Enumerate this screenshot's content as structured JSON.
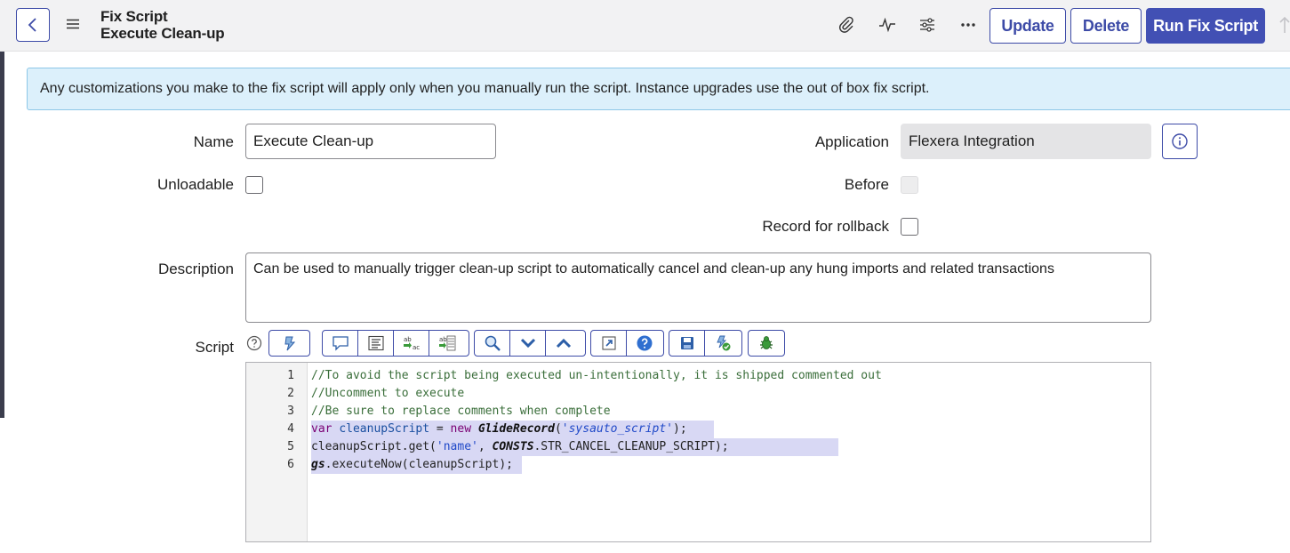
{
  "header": {
    "title": "Fix Script",
    "subtitle": "Execute Clean-up",
    "buttons": {
      "update": "Update",
      "delete": "Delete",
      "run": "Run Fix Script"
    },
    "accent_color": "#4250b4"
  },
  "banner": {
    "text": "Any customizations you make to the fix script will apply only when you manually run the script. Instance upgrades use the out of box fix script."
  },
  "form": {
    "name": {
      "label": "Name",
      "value": "Execute Clean-up"
    },
    "unloadable": {
      "label": "Unloadable",
      "checked": false
    },
    "application": {
      "label": "Application",
      "value": "Flexera Integration"
    },
    "before": {
      "label": "Before",
      "checked": false
    },
    "record_for_rollback": {
      "label": "Record for rollback",
      "checked": false
    },
    "description": {
      "label": "Description",
      "value": "Can be used to manually trigger clean-up script to automatically cancel and clean-up any hung imports and related transactions"
    },
    "script": {
      "label": "Script"
    }
  },
  "editor": {
    "line_numbers": [
      "1",
      "2",
      "3",
      "4",
      "5",
      "6"
    ],
    "lines": [
      {
        "t1": "//To avoid the script being executed un-intentionally, it is shipped commented out"
      },
      {
        "t1": "//Uncomment to execute"
      },
      {
        "t1": "//Be sure to replace comments when complete"
      },
      {
        "t1": "var",
        "t2": " ",
        "t3": "cleanupScript",
        "t4": " = ",
        "t5": "new",
        "t6": " ",
        "t7": "GlideRecord",
        "t8": "(",
        "t9": "'sysauto_script'",
        "t10": ");"
      },
      {
        "t1": "cleanupScript.get(",
        "t2": "'name'",
        "t3": ", ",
        "t4": "CONSTS",
        "t5": ".STR_CANCEL_CLEANUP_SCRIPT);"
      },
      {
        "t1": "gs",
        "t2": ".executeNow(cleanupScript);"
      }
    ]
  },
  "icons": [
    "back-chevron-icon",
    "hamburger-menu-icon",
    "paperclip-icon",
    "activity-icon",
    "sliders-icon",
    "more-options-icon",
    "info-icon",
    "help-icon"
  ]
}
